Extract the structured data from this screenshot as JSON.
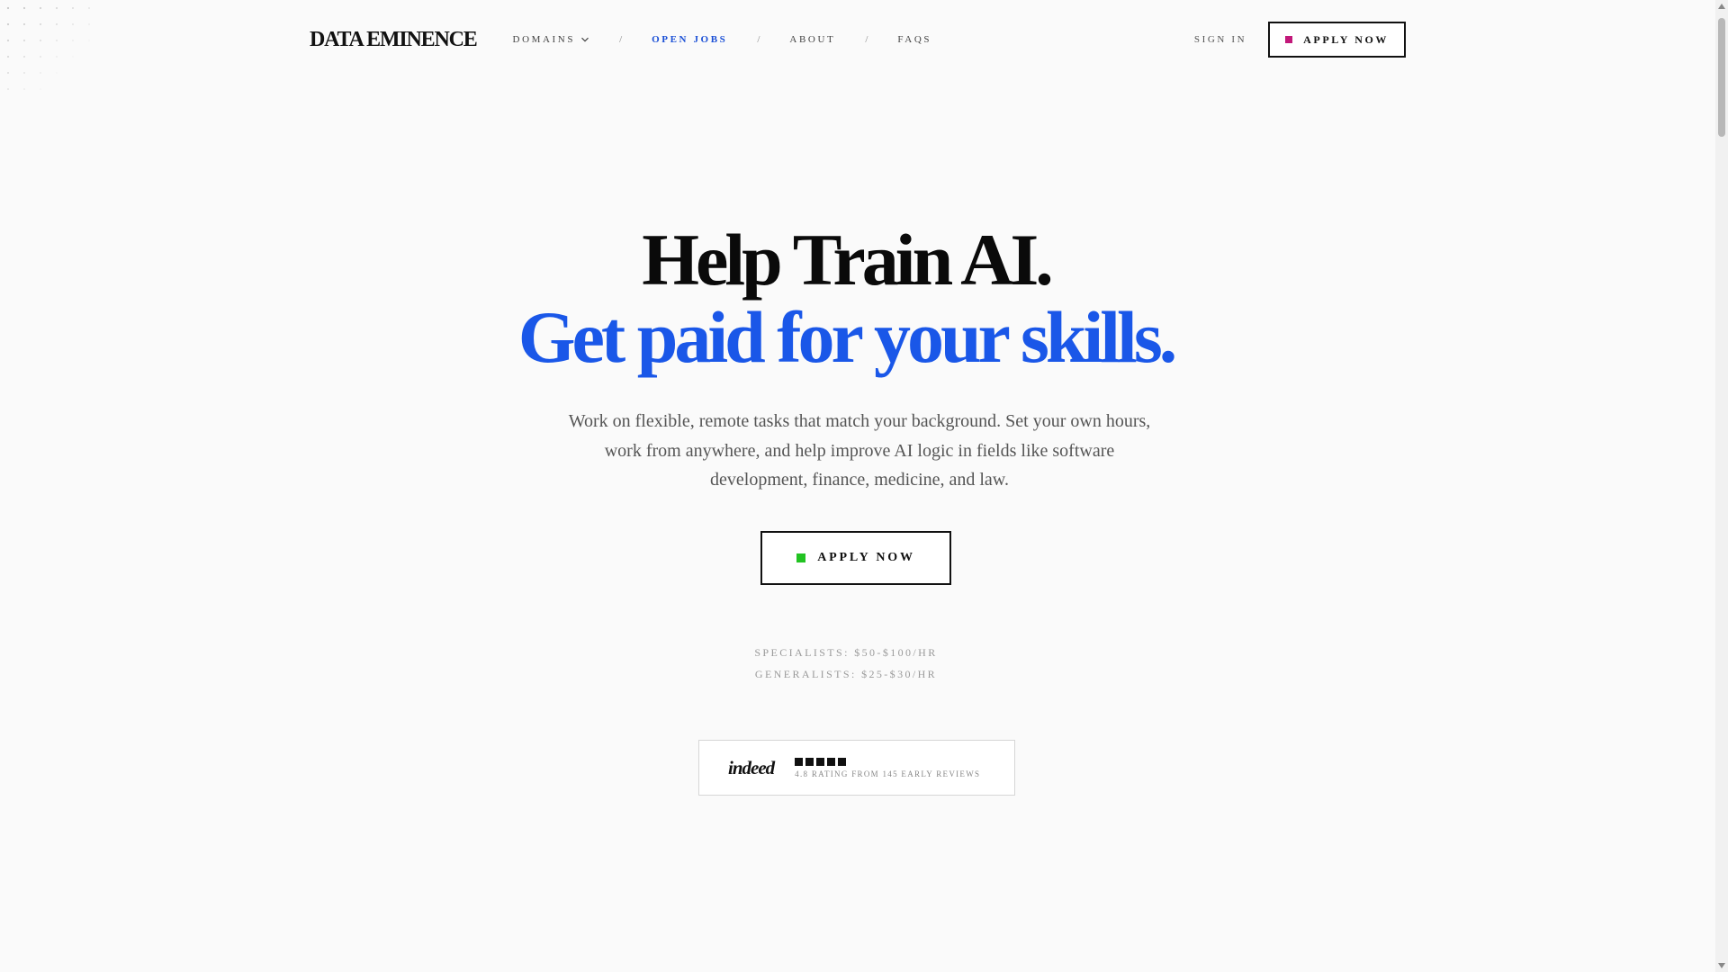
{
  "nav": {
    "logo": "DATA EMINENCE",
    "links": [
      {
        "label": "DOMAINS",
        "has_dropdown": true
      },
      {
        "label": "OPEN JOBS",
        "active": true
      },
      {
        "label": "ABOUT"
      },
      {
        "label": "FAQS"
      }
    ],
    "separator": "/",
    "sign_in": "SIGN IN",
    "apply": "APPLY NOW"
  },
  "hero": {
    "headline_1": "Help Train AI.",
    "headline_2": "Get paid for your skills.",
    "lead": "Work on flexible, remote tasks that match your background. Set your own hours, work from anywhere, and help improve AI logic in fields like software development, finance, medicine, and law.",
    "apply": "APPLY NOW",
    "rates": [
      "SPECIALISTS: $50-$100/HR",
      "GENERALISTS: $25-$30/HR"
    ]
  },
  "review": {
    "brand": "indeed",
    "stars": 5,
    "text": "4.8 RATING FROM 145 EARLY REVIEWS"
  },
  "colors": {
    "accent_blue": "#1a57e8",
    "active_link": "#1a4fd6",
    "magenta": "#c2187a",
    "green": "#22c322"
  }
}
